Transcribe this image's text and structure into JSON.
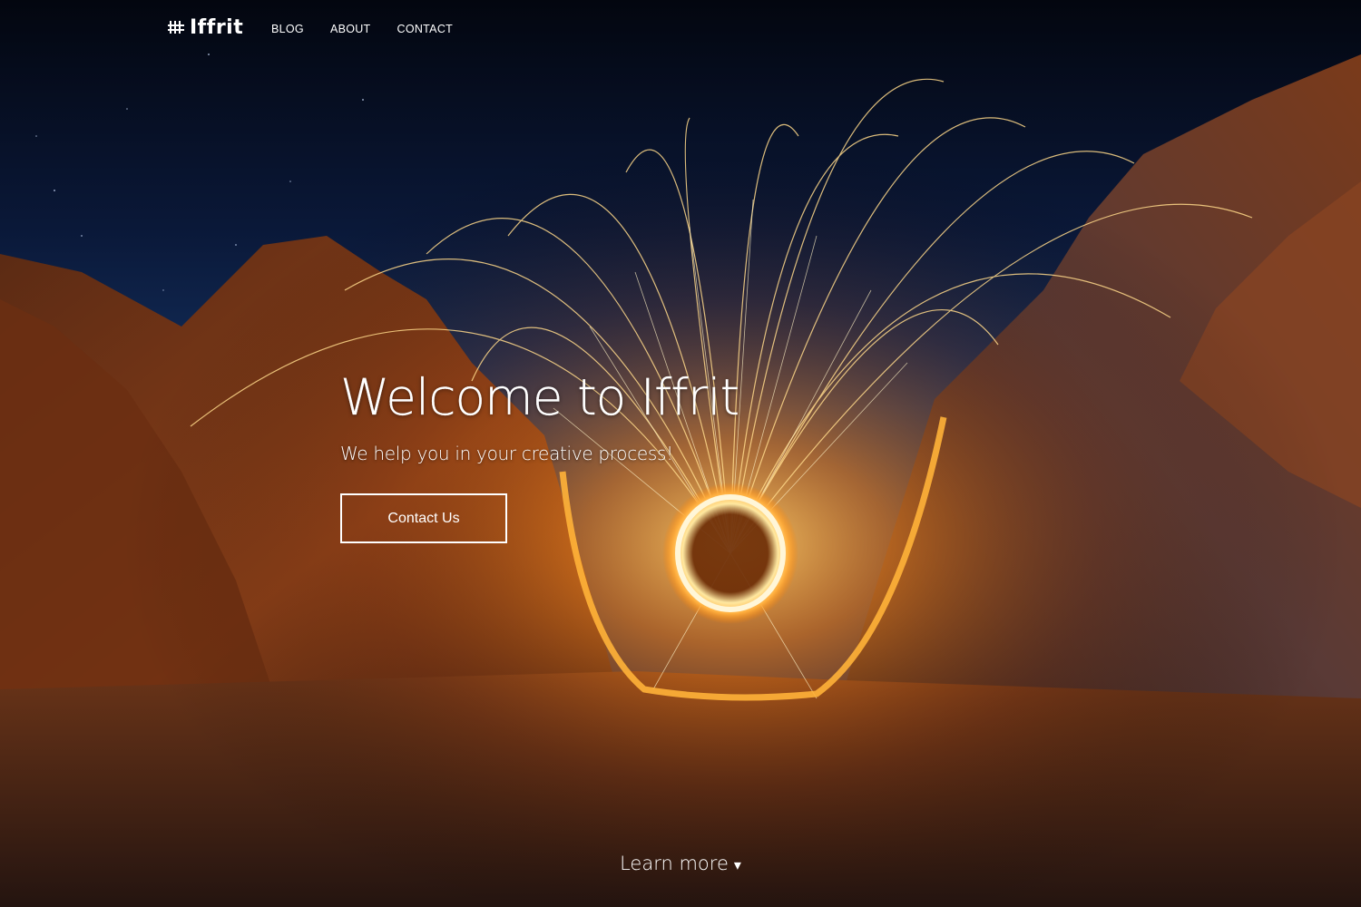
{
  "navbar": {
    "brand": "Iffrit",
    "links": [
      "BLOG",
      "ABOUT",
      "CONTACT"
    ]
  },
  "hero": {
    "title": "Welcome to Iffrit",
    "subtitle": "We help you in your creative process!",
    "cta_label": "Contact Us",
    "learn_more": "Learn more",
    "learn_more_icon": "▾"
  },
  "icons": {
    "brand": "hash-grid-icon",
    "learn_more": "triangle-down-icon"
  },
  "colors": {
    "text": "#ffffff",
    "sky_top": "#050a1a",
    "sky_mid": "#0e2550",
    "fire": "#ff9a2a",
    "rock": "#4a2617"
  }
}
